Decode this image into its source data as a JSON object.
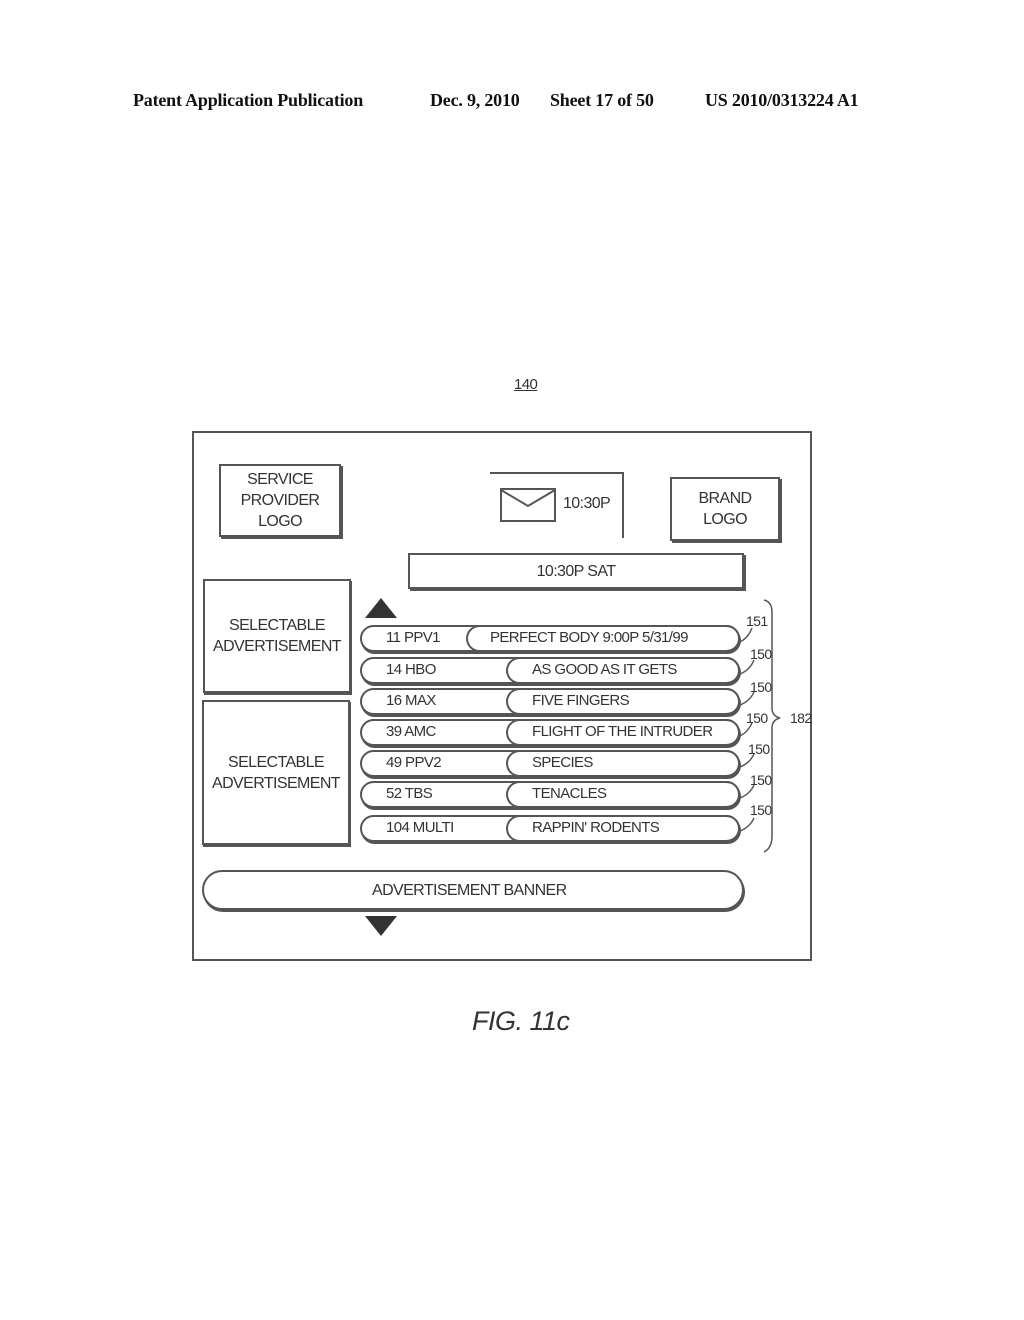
{
  "header": {
    "publication": "Patent Application Publication",
    "date": "Dec. 9, 2010",
    "sheet": "Sheet 17 of 50",
    "number": "US 2010/0313224 A1"
  },
  "figure": {
    "reference": "140",
    "caption": "FIG. 11c"
  },
  "screen": {
    "service_provider_logo": [
      "SERVICE",
      "PROVIDER",
      "LOGO"
    ],
    "mail_time": "10:30P",
    "brand_logo": [
      "BRAND",
      "LOGO"
    ],
    "time_bar": "10:30P SAT",
    "selectable_ads": [
      {
        "line1": "SELECTABLE",
        "line2": "ADVERTISEMENT"
      },
      {
        "line1": "SELECTABLE",
        "line2": "ADVERTISEMENT"
      }
    ],
    "listings": [
      {
        "channel": "11 PPV1",
        "program": "PERFECT BODY 9:00P 5/31/99",
        "ref": "151"
      },
      {
        "channel": "14 HBO",
        "program": "AS GOOD AS IT GETS",
        "ref": "150"
      },
      {
        "channel": "16 MAX",
        "program": "FIVE FINGERS",
        "ref": "150"
      },
      {
        "channel": "39 AMC",
        "program": "FLIGHT OF THE INTRUDER",
        "ref": "150"
      },
      {
        "channel": "49 PPV2",
        "program": "SPECIES",
        "ref": "150"
      },
      {
        "channel": "52 TBS",
        "program": "TENACLES",
        "ref": "150"
      },
      {
        "channel": "104 MULTI",
        "program": "RAPPIN' RODENTS",
        "ref": "150"
      }
    ],
    "group_ref": "182",
    "ad_banner": "ADVERTISEMENT BANNER",
    "icons": {
      "mail": "envelope-icon",
      "scroll_up": "up-triangle-icon",
      "scroll_down": "down-triangle-icon"
    }
  }
}
